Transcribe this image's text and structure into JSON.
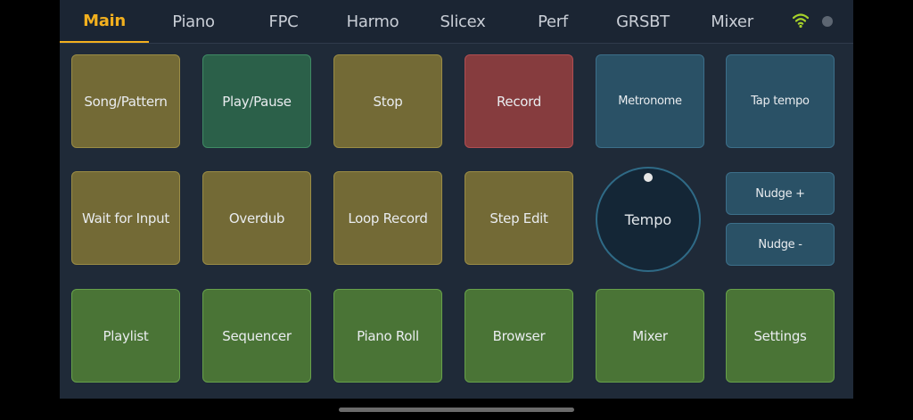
{
  "tabs": [
    {
      "label": "Main",
      "active": true
    },
    {
      "label": "Piano"
    },
    {
      "label": "FPC"
    },
    {
      "label": "Harmo"
    },
    {
      "label": "Slicex"
    },
    {
      "label": "Perf"
    },
    {
      "label": "GRSBT"
    },
    {
      "label": "Mixer"
    }
  ],
  "status": {
    "wifi_icon": "wifi-icon",
    "wifi_color": "#a6d12a",
    "indicator_color": "#5d6672"
  },
  "pads": {
    "song_pattern": "Song/Pattern",
    "play_pause": "Play/Pause",
    "stop": "Stop",
    "record": "Record",
    "metronome": "Metronome",
    "tap_tempo": "Tap tempo",
    "wait_for_input": "Wait for Input",
    "overdub": "Overdub",
    "loop_record": "Loop Record",
    "step_edit": "Step Edit",
    "nudge_plus": "Nudge +",
    "nudge_minus": "Nudge -",
    "playlist": "Playlist",
    "sequencer": "Sequencer",
    "piano_roll": "Piano Roll",
    "browser": "Browser",
    "mixer": "Mixer",
    "settings": "Settings"
  },
  "tempo": {
    "label": "Tempo"
  },
  "colors": {
    "olive": "#736a36",
    "teal_green": "#2b6049",
    "red": "#863c3e",
    "blue": "#2a5166",
    "green": "#4a7436",
    "accent": "#f2b01e"
  }
}
